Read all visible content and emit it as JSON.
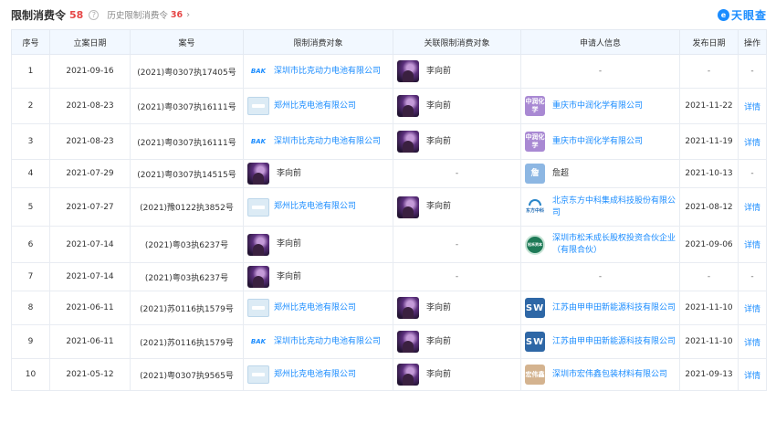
{
  "header": {
    "title": "限制消费令",
    "count": "58",
    "history_label": "历史限制消费令",
    "history_count": "36",
    "brand": "天眼查"
  },
  "columns": [
    "序号",
    "立案日期",
    "案号",
    "限制消费对象",
    "关联限制消费对象",
    "申请人信息",
    "发布日期",
    "操作"
  ],
  "rows": [
    {
      "no": "1",
      "date": "2021-09-16",
      "case": "(2021)粤0307执17405号",
      "target_logo": "bak",
      "target": "深圳市比克动力电池有限公司",
      "target_link": true,
      "related": "李向前",
      "applicant_logo": "",
      "applicant": "-",
      "pub": "-",
      "op": "-"
    },
    {
      "no": "2",
      "date": "2021-08-23",
      "case": "(2021)粤0307执16111号",
      "target_logo": "zheng",
      "target": "郑州比克电池有限公司",
      "target_link": true,
      "related": "李向前",
      "applicant_logo": "zr",
      "applicant_logo_text": "中润化学",
      "applicant": "重庆市中润化学有限公司",
      "applicant_link": true,
      "pub": "2021-11-22",
      "op": "详情"
    },
    {
      "no": "3",
      "date": "2021-08-23",
      "case": "(2021)粤0307执16111号",
      "target_logo": "bak",
      "target": "深圳市比克动力电池有限公司",
      "target_link": true,
      "related": "李向前",
      "applicant_logo": "zr",
      "applicant_logo_text": "中润化学",
      "applicant": "重庆市中润化学有限公司",
      "applicant_link": true,
      "pub": "2021-11-19",
      "op": "详情"
    },
    {
      "no": "4",
      "date": "2021-07-29",
      "case": "(2021)粤0307执14515号",
      "target_logo": "avatar",
      "target": "李向前",
      "target_link": false,
      "related": "-",
      "applicant_logo": "ch",
      "applicant_logo_text": "詹",
      "applicant": "詹超",
      "applicant_link": false,
      "pub": "2021-10-13",
      "op": "-"
    },
    {
      "no": "5",
      "date": "2021-07-27",
      "case": "(2021)豫0122执3852号",
      "target_logo": "zheng",
      "target": "郑州比克电池有限公司",
      "target_link": true,
      "related": "李向前",
      "applicant_logo": "df",
      "applicant_logo_text": "东方中科",
      "applicant": "北京东方中科集成科技股份有限公司",
      "applicant_link": true,
      "pub": "2021-08-12",
      "op": "详情"
    },
    {
      "no": "6",
      "date": "2021-07-14",
      "case": "(2021)粤03执6237号",
      "target_logo": "avatar",
      "target": "李向前",
      "target_link": false,
      "related": "-",
      "applicant_logo": "sh",
      "applicant_logo_text": "松禾资本",
      "applicant": "深圳市松禾成长股权投资合伙企业（有限合伙）",
      "applicant_link": true,
      "pub": "2021-09-06",
      "op": "详情"
    },
    {
      "no": "7",
      "date": "2021-07-14",
      "case": "(2021)粤03执6237号",
      "target_logo": "avatar",
      "target": "李向前",
      "target_link": false,
      "related": "-",
      "applicant_logo": "",
      "applicant": "-",
      "pub": "-",
      "op": "-"
    },
    {
      "no": "8",
      "date": "2021-06-11",
      "case": "(2021)苏0116执1579号",
      "target_logo": "zheng",
      "target": "郑州比克电池有限公司",
      "target_link": true,
      "related": "李向前",
      "applicant_logo": "sw",
      "applicant_logo_text": "SW",
      "applicant": "江苏由甲申田新能源科技有限公司",
      "applicant_link": true,
      "pub": "2021-11-10",
      "op": "详情"
    },
    {
      "no": "9",
      "date": "2021-06-11",
      "case": "(2021)苏0116执1579号",
      "target_logo": "bak",
      "target": "深圳市比克动力电池有限公司",
      "target_link": true,
      "related": "李向前",
      "applicant_logo": "sw",
      "applicant_logo_text": "SW",
      "applicant": "江苏由甲申田新能源科技有限公司",
      "applicant_link": true,
      "pub": "2021-11-10",
      "op": "详情"
    },
    {
      "no": "10",
      "date": "2021-05-12",
      "case": "(2021)粤0307执9565号",
      "target_logo": "zheng",
      "target": "郑州比克电池有限公司",
      "target_link": true,
      "related": "李向前",
      "applicant_logo": "hw",
      "applicant_logo_text": "宏伟鑫",
      "applicant": "深圳市宏伟鑫包装材料有限公司",
      "applicant_link": true,
      "pub": "2021-09-13",
      "op": "详情"
    }
  ],
  "logo_texts": {
    "bak": "BAK"
  }
}
